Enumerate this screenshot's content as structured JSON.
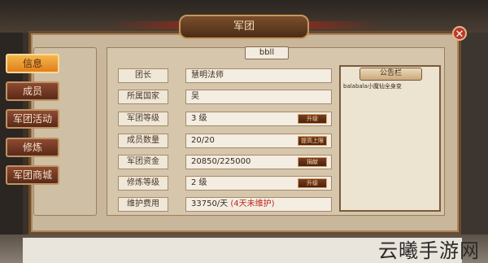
{
  "window": {
    "title": "军团"
  },
  "legion_tag": "bbll",
  "sidebar": {
    "items": [
      {
        "label": "信息",
        "active": true
      },
      {
        "label": "成员",
        "active": false
      },
      {
        "label": "军团活动",
        "active": false
      },
      {
        "label": "修炼",
        "active": false
      },
      {
        "label": "军团商城",
        "active": false
      }
    ]
  },
  "info": {
    "rows": [
      {
        "label": "团长",
        "value": "慧明法师"
      },
      {
        "label": "所属国家",
        "value": "吴"
      },
      {
        "label": "军团等级",
        "value": "3 级",
        "button": "升级"
      },
      {
        "label": "成员数量",
        "value": "20/20",
        "button": "提高上限"
      },
      {
        "label": "军团资金",
        "value": "20850/225000",
        "button": "捐献"
      },
      {
        "label": "修炼等级",
        "value": "2 级",
        "button": "升级"
      },
      {
        "label": "维护费用",
        "value": "33750/天",
        "warning": "(4天未维护)"
      }
    ]
  },
  "notice": {
    "title": "公告栏",
    "text": "balabala小魔仙全身变"
  },
  "watermark": "云曦手游网",
  "colors": {
    "active_tab": "#e9952c",
    "warning": "#c0261c"
  }
}
